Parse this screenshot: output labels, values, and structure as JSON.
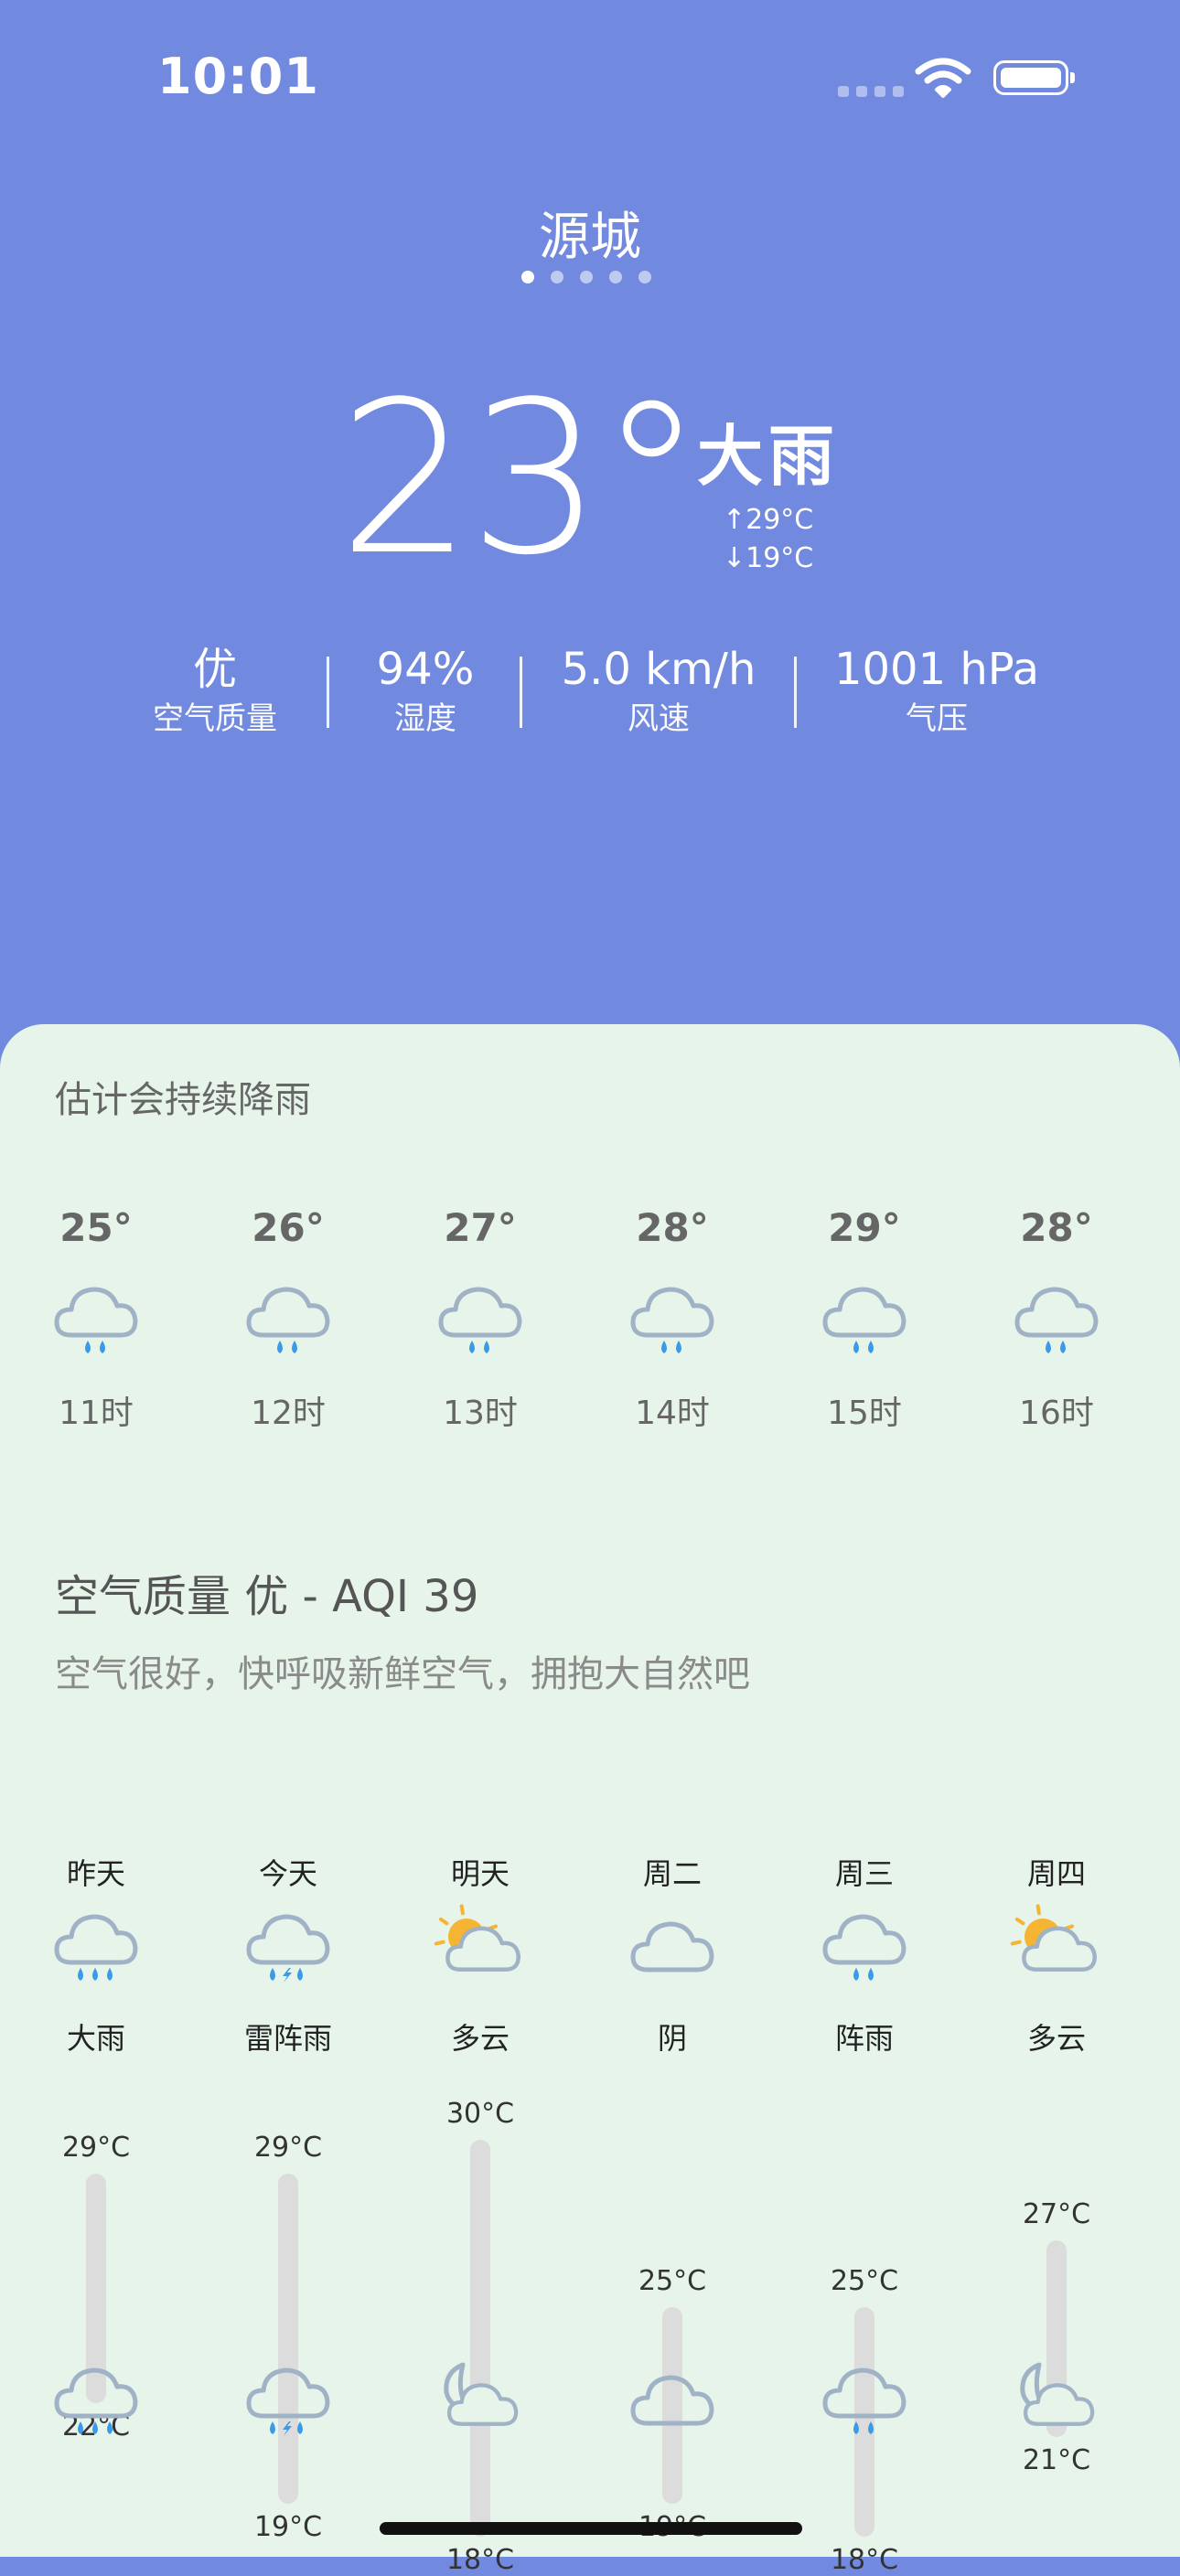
{
  "status_bar": {
    "time": "10:01"
  },
  "header": {
    "city": "源城",
    "page_count": 5,
    "active_page": 0
  },
  "current": {
    "temperature": "23°",
    "condition": "大雨",
    "high": "↑29°C",
    "low": "↓19°C"
  },
  "stats": [
    {
      "value": "优",
      "label": "空气质量"
    },
    {
      "value": "94%",
      "label": "湿度"
    },
    {
      "value": "5.0 km/h",
      "label": "风速"
    },
    {
      "value": "1001 hPa",
      "label": "气压"
    }
  ],
  "hourly": {
    "summary": "估计会持续降雨",
    "items": [
      {
        "temp": "25°",
        "hour": "11时",
        "icon": "rain-cloud-icon"
      },
      {
        "temp": "26°",
        "hour": "12时",
        "icon": "rain-cloud-icon"
      },
      {
        "temp": "27°",
        "hour": "13时",
        "icon": "rain-cloud-icon"
      },
      {
        "temp": "28°",
        "hour": "14时",
        "icon": "rain-cloud-icon"
      },
      {
        "temp": "29°",
        "hour": "15时",
        "icon": "rain-cloud-icon"
      },
      {
        "temp": "28°",
        "hour": "16时",
        "icon": "rain-cloud-icon"
      }
    ]
  },
  "air_quality": {
    "title": "空气质量 优 - AQI 39",
    "description": "空气很好，快呼吸新鲜空气，拥抱大自然吧"
  },
  "daily": [
    {
      "day": "昨天",
      "condition": "大雨",
      "high": "29°C",
      "low": "22°C",
      "day_icon": "heavy-rain-icon",
      "night_icon": "heavy-rain-icon"
    },
    {
      "day": "今天",
      "condition": "雷阵雨",
      "high": "29°C",
      "low": "19°C",
      "day_icon": "thunderstorm-icon",
      "night_icon": "thunderstorm-icon"
    },
    {
      "day": "明天",
      "condition": "多云",
      "high": "30°C",
      "low": "18°C",
      "day_icon": "partly-cloudy-day-icon",
      "night_icon": "partly-cloudy-night-icon"
    },
    {
      "day": "周二",
      "condition": "阴",
      "high": "25°C",
      "low": "19°C",
      "day_icon": "cloud-icon",
      "night_icon": "cloud-icon"
    },
    {
      "day": "周三",
      "condition": "阵雨",
      "high": "25°C",
      "low": "18°C",
      "day_icon": "shower-icon",
      "night_icon": "shower-icon"
    },
    {
      "day": "周四",
      "condition": "多云",
      "high": "27°C",
      "low": "21°C",
      "day_icon": "partly-cloudy-day-icon",
      "night_icon": "partly-cloudy-night-icon"
    }
  ],
  "colors": {
    "background": "#7189de",
    "card": "#e6f4ea",
    "cloud_outline": "#9fb2c6",
    "rain": "#3a9ae8",
    "sun": "#f5b532"
  }
}
